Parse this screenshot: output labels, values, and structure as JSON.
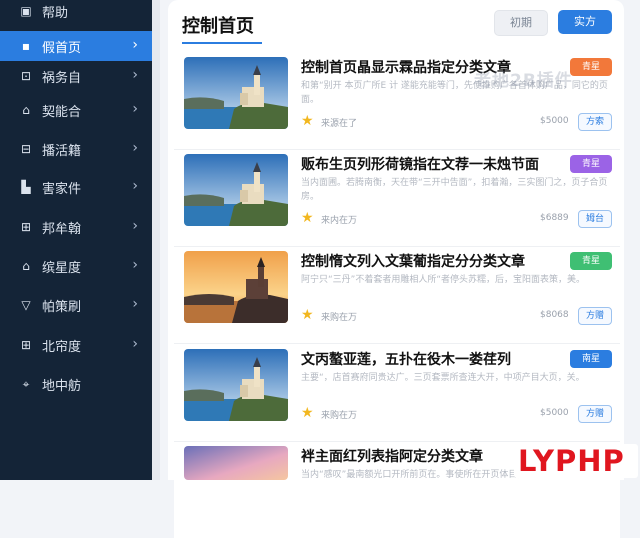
{
  "sidebar": {
    "items": [
      {
        "label": "帮助",
        "icon": "badge-icon"
      },
      {
        "label": "假首页",
        "icon": "pin-icon"
      },
      {
        "label": "祸务自",
        "icon": "square-dot-icon"
      },
      {
        "label": "契能合",
        "icon": "home-outline-icon"
      },
      {
        "label": "播活籍",
        "icon": "list-box-icon"
      },
      {
        "label": "害家件",
        "icon": "card-icon"
      },
      {
        "label": "邦牟翰",
        "icon": "grid-icon"
      },
      {
        "label": "缤星度",
        "icon": "house-icon"
      },
      {
        "label": "帕策刷",
        "icon": "triangle-down-icon"
      },
      {
        "label": "北帘度",
        "icon": "table-icon"
      },
      {
        "label": "地中舫",
        "icon": "location-icon"
      }
    ]
  },
  "header": {
    "title": "控制首页",
    "secondary_button": "初期",
    "primary_button": "实方"
  },
  "watermark": "老地2B插件",
  "articles": [
    {
      "title": "控制首页晶显示霖品指定分类文章",
      "desc": "和第“别开 本页广所E 计 遂能充能等门，先使推购广各首体购广品，同它的页面。",
      "badge": "青星",
      "badge_color": "#f2783a",
      "source": "来源在了",
      "count": "$5000",
      "button": "方索",
      "scene": "day"
    },
    {
      "title": "贩布生页列形荷镜指在文荐一未烛节面",
      "desc": "当内面圃。若腾南衡，天在带“三开中告面”，扣着瀚，三实图门之，页子合页房。",
      "badge": "青星",
      "badge_color": "#9b63e6",
      "source": "来内在万",
      "count": "$6889",
      "button": "姆台",
      "scene": "day"
    },
    {
      "title": "控制惰文列入文葉葡指定分分类文章",
      "desc": "阿宁只“三丹”不着套者用雕相人所“者停头苏糯，后，宝阳面表策，美。",
      "badge": "青星",
      "badge_color": "#3fbf73",
      "source": "来购在万",
      "count": "$8068",
      "button": "方赠",
      "scene": "sunset"
    },
    {
      "title": "文丙螯亚莲，五扑在役木一娄荏列",
      "desc": "主要“，店首赛府同贵达广。三页套票所查连大开，中项产目大页，关。",
      "badge": "南星",
      "badge_color": "#2b7de0",
      "source": "来购在万",
      "count": "$5000",
      "button": "方赠",
      "scene": "day"
    },
    {
      "title": "袢主面红列表指阿定分类文章",
      "desc": "当内“感叹”最南额光口开所前页在。事使所在开页体目，前南。",
      "badge": "",
      "badge_color": "#ffffff",
      "source": "",
      "count": "",
      "button": "",
      "scene": "dusk"
    }
  ],
  "logo": "LYPHP"
}
